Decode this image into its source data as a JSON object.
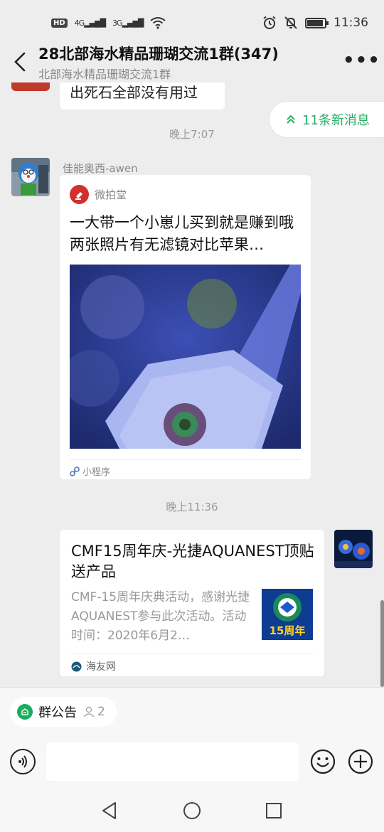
{
  "status_bar": {
    "hd_badge": "HD",
    "signal1": "4G",
    "signal2": "3G",
    "time": "11:36"
  },
  "header": {
    "title": "28北部海水精品珊瑚交流1群(347)",
    "subtitle": "北部海水精品珊瑚交流1群",
    "more_label": "•••"
  },
  "chat": {
    "prev_message": "出死石全部没有用过",
    "new_messages": "11条新消息",
    "timestamp1": "晚上7:07",
    "timestamp2": "晚上11:36",
    "message1": {
      "sender": "佳能奥西-awen",
      "app_name": "微拍堂",
      "title": "一大带一个小崽儿买到就是赚到哦两张照片有无滤镜对比苹果…",
      "footer": "小程序"
    },
    "message2": {
      "title": "CMF15周年庆-光捷AQUANEST顶贴送产品",
      "description": "CMF-15周年庆典活动，感谢光捷AQUANEST参与此次活动。活动时间：2020年6月2…",
      "thumb_text": "15周年",
      "source": "海友网"
    }
  },
  "notice": {
    "label": "群公告",
    "count": "2"
  },
  "input": {
    "placeholder": ""
  },
  "colors": {
    "accent_green": "#2aae67",
    "background": "#ededed"
  }
}
